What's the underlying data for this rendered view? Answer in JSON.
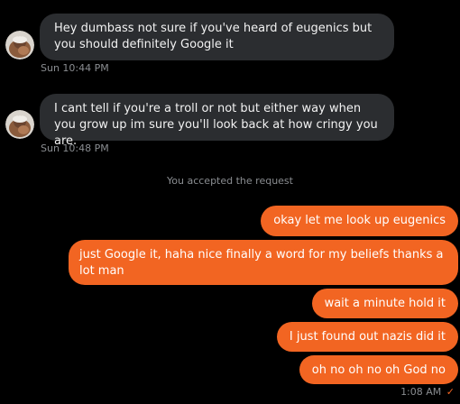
{
  "messages_in": [
    {
      "text": "Hey dumbass not sure if you've heard of eugenics but you should definitely Google it",
      "time": "Sun 10:44 PM"
    },
    {
      "text": "I cant tell if you're a troll or not but either way when you grow up im sure you'll look back at how cringy you are.",
      "time": "Sun 10:48 PM"
    }
  ],
  "system_notice": "You accepted the request",
  "messages_out": [
    {
      "text": "okay let me look up eugenics"
    },
    {
      "text": "just Google it, haha nice finally a word for my beliefs thanks a lot man"
    },
    {
      "text": "wait a minute hold it"
    },
    {
      "text": "I just found out nazis did it"
    },
    {
      "text": "oh no oh no oh God no"
    }
  ],
  "last_sent": {
    "time": "1:08 AM",
    "status_icon": "check-icon"
  },
  "colors": {
    "background": "#000000",
    "incoming_bubble": "#2b2d30",
    "outgoing_bubble": "#f26522",
    "meta_text": "#8a8d91"
  }
}
